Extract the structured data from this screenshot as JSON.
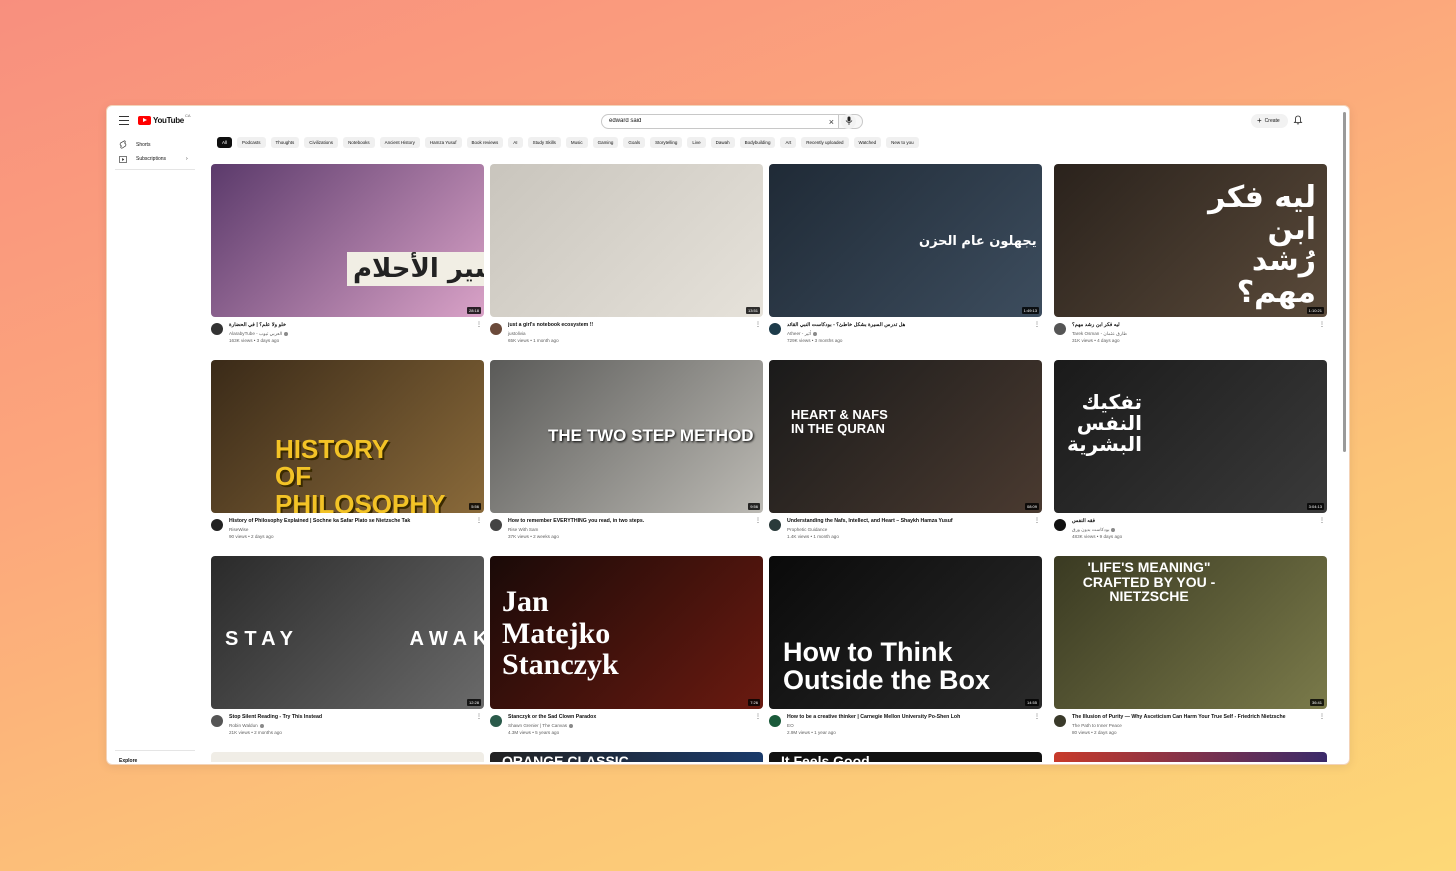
{
  "header": {
    "logo_text": "YouTube",
    "logo_region": "CA",
    "search_value": "edward said",
    "create_label": "Create"
  },
  "sidebar": {
    "items": [
      {
        "label": "Shorts",
        "icon": "shorts-icon"
      },
      {
        "label": "Subscriptions",
        "icon": "subscriptions-icon"
      }
    ],
    "explore_label": "Explore"
  },
  "chips": [
    "All",
    "Podcasts",
    "Thoughts",
    "Civilizations",
    "Notebooks",
    "Ancient History",
    "Hamza Yusuf",
    "Book reviews",
    "AI",
    "Study Skills",
    "Music",
    "Gaming",
    "Goals",
    "Storytelling",
    "Live",
    "Dawah",
    "Bodybuilding",
    "Art",
    "Recently uploaded",
    "Watched",
    "New to you"
  ],
  "videos": [
    {
      "title": "خلو ولا علم؟ | في الحضارة",
      "channel": "AlarabyTube - العربي تيوب",
      "verified": true,
      "stats": "163K views • 3 days ago",
      "duration": "28:18",
      "thumb_text": "تفسير الأحلام",
      "colors": [
        "#5b3a6b",
        "#d9a2c7"
      ],
      "avatar_color": "#333"
    },
    {
      "title": "just a girl's notebook ecosystem !!",
      "channel": "justolivia",
      "verified": false,
      "stats": "65K views • 1 month ago",
      "duration": "13:51",
      "thumb_text": "",
      "colors": [
        "#c9c5bd",
        "#e6e2da"
      ],
      "avatar_color": "#6b4a3a"
    },
    {
      "title": "هل تدرس السيرة بشكل خاطئ؟ - بودكاست النبي القائد",
      "channel": "Atheer - أثير",
      "verified": true,
      "stats": "729K views • 3 months ago",
      "duration": "1:49:13",
      "thumb_text": "شباب اليوم يجهلون عام الحزن",
      "colors": [
        "#1f2a36",
        "#3d4d5e"
      ],
      "avatar_color": "#1d3b4a"
    },
    {
      "title": "ليه فكر ابن رشد مهم؟",
      "channel": "Tarek Osman - طارق عثمان",
      "verified": false,
      "stats": "31K views • 4 days ago",
      "duration": "1:10:21",
      "thumb_text": "ليه فكر ابن رُشد مهم؟",
      "colors": [
        "#2a221c",
        "#5a4a3a"
      ],
      "avatar_color": "#555"
    },
    {
      "title": "History of Philosophy Explained | Sochne ka Safar Plato se Nietzsche Tak",
      "channel": "RiseWise",
      "verified": false,
      "stats": "90 views • 2 days ago",
      "duration": "5:56",
      "thumb_text": "HISTORY OF PHILOSOPHY",
      "colors": [
        "#3a2a18",
        "#8a6a3a"
      ],
      "avatar_color": "#222"
    },
    {
      "title": "How to remember EVERYTHING you read, in two steps.",
      "channel": "Rise With Sam",
      "verified": false,
      "stats": "37K views • 2 weeks ago",
      "duration": "9:56",
      "thumb_text": "THE TWO STEP METHOD",
      "colors": [
        "#5a5a58",
        "#bcbab4"
      ],
      "avatar_color": "#444"
    },
    {
      "title": "Understanding the Nafs, Intellect, and Heart – Shaykh Hamza Yusuf",
      "channel": "Prophetic Guidance",
      "verified": false,
      "stats": "1.4K views • 1 month ago",
      "duration": "08:09",
      "thumb_text": "HEART & NAFS IN THE QURAN",
      "colors": [
        "#1a1a1a",
        "#4a3a30"
      ],
      "avatar_color": "#2a3a3a"
    },
    {
      "title": "فقه النفس",
      "channel": "بودكاست بدون ورق",
      "verified": true,
      "stats": "483K views • 9 days ago",
      "duration": "3:04:13",
      "thumb_text": "تفكيك النفس البشرية",
      "colors": [
        "#1a1a1a",
        "#3a3a3a"
      ],
      "avatar_color": "#111"
    },
    {
      "title": "Stop Silent Reading - Try This Instead",
      "channel": "Robin Waldun",
      "verified": true,
      "stats": "21K views • 2 months ago",
      "duration": "12:28",
      "thumb_text": "STAY AWAKE",
      "colors": [
        "#2a2a2a",
        "#6a6a6a"
      ],
      "avatar_color": "#555"
    },
    {
      "title": "Stanczyk or the Sad Clown Paradox",
      "channel": "Shawn Grenier | The Canvas",
      "verified": true,
      "stats": "4.3M views • 5 years ago",
      "duration": "7:26",
      "thumb_text": "Jan Matejko Stanczyk",
      "colors": [
        "#1a0a08",
        "#6a1a10"
      ],
      "avatar_color": "#2a5a4a"
    },
    {
      "title": "How to be a creative thinker | Carnegie Mellon University Po-Shen Loh",
      "channel": "EO",
      "verified": false,
      "stats": "2.9M views • 1 year ago",
      "duration": "14:55",
      "thumb_text": "How to Think Outside the Box",
      "colors": [
        "#0a0a0a",
        "#2a2a2a"
      ],
      "avatar_color": "#1a5a3a"
    },
    {
      "title": "The Illusion of Purity — Why Asceticism Can Harm Your True Self - Friedrich Nietzsche",
      "channel": "The Path to Inner Peace",
      "verified": false,
      "stats": "80 views • 2 days ago",
      "duration": "36:41",
      "thumb_text": "'LIFE'S MEANING\" CRAFTED BY YOU - NIETZSCHE",
      "colors": [
        "#3a3a22",
        "#7a7a4a"
      ],
      "avatar_color": "#3a3a2a"
    }
  ],
  "row4_thumbs": [
    {
      "colors": [
        "#f0ede6",
        "#f0ede6"
      ],
      "text": ""
    },
    {
      "colors": [
        "#222",
        "#1a3a6a"
      ],
      "text": "ORANGE CLASSIC"
    },
    {
      "colors": [
        "#111",
        "#111"
      ],
      "text": "It Feels Good"
    },
    {
      "colors": [
        "#c83a2a",
        "#3a2a6a"
      ],
      "text": ""
    }
  ]
}
